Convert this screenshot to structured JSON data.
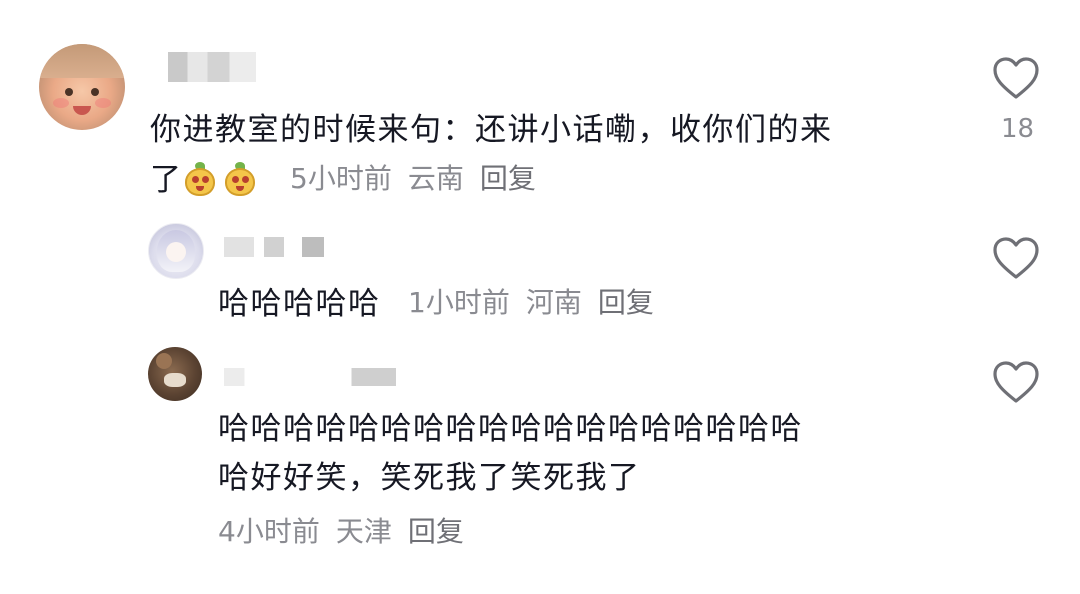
{
  "comments": [
    {
      "text_line1": "你进教室的时候来句：还讲小话嘞，收你们的来",
      "text_line2": "了",
      "emoji_name": "peanut-emoji",
      "time": "5小时前",
      "region": "云南",
      "reply_label": "回复",
      "likes": "18"
    }
  ],
  "replies": [
    {
      "text_line1": "哈哈哈哈哈",
      "time": "1小时前",
      "region": "河南",
      "reply_label": "回复"
    },
    {
      "text_line1": "哈哈哈哈哈哈哈哈哈哈哈哈哈哈哈哈哈哈",
      "text_line2": "哈好好笑，笑死我了笑死我了",
      "time": "4小时前",
      "region": "天津",
      "reply_label": "回复"
    }
  ],
  "colors": {
    "text": "#161823",
    "meta": "#8a8b91",
    "heart_stroke": "#6f7076"
  }
}
